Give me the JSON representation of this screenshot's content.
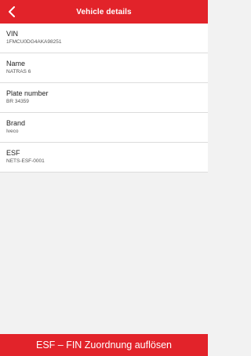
{
  "header": {
    "title": "Vehicle details",
    "back_icon": "chevron-left-icon"
  },
  "details": [
    {
      "label": "VIN",
      "value": "1FMCU0DG4AKA98251"
    },
    {
      "label": "Name",
      "value": "NATRAS 6"
    },
    {
      "label": "Plate number",
      "value": "BR 34359"
    },
    {
      "label": "Brand",
      "value": "Iveco"
    },
    {
      "label": "ESF",
      "value": "NETS-ESF-0001"
    }
  ],
  "action": {
    "label": "ESF – FIN Zuordnung auflösen"
  },
  "colors": {
    "accent": "#e2232a",
    "background": "#f2f2f2",
    "surface": "#ffffff"
  }
}
